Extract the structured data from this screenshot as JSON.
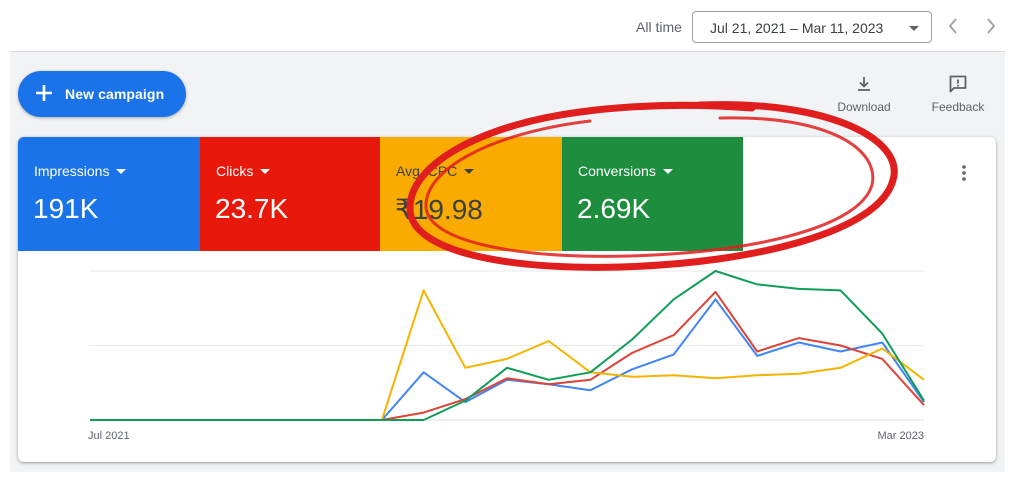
{
  "header": {
    "all_time_label": "All time",
    "date_range": "Jul 21, 2021 – Mar 11, 2023"
  },
  "toolbar": {
    "new_campaign_label": "New campaign",
    "download_label": "Download",
    "feedback_label": "Feedback"
  },
  "metrics": [
    {
      "label": "Impressions",
      "value": "191K",
      "color": "#1a73e8"
    },
    {
      "label": "Clicks",
      "value": "23.7K",
      "color": "#e8190a"
    },
    {
      "label": "Avg. CPC",
      "value": "₹19.98",
      "color": "#f9ab00"
    },
    {
      "label": "Conversions",
      "value": "2.69K",
      "color": "#1e8e3e"
    }
  ],
  "colors": {
    "annotation": "#e01e1e",
    "panel_bg": "#f1f3f4"
  },
  "chart_data": {
    "type": "line",
    "x_tick_labels": [
      "Jul 2021",
      "Mar 2023"
    ],
    "gridlines": 3,
    "ylim": [
      0,
      100
    ],
    "series": [
      {
        "name": "Impressions",
        "color": "#4285f4",
        "values": [
          0,
          0,
          0,
          0,
          0,
          0,
          0,
          0,
          32,
          12,
          27,
          24,
          20,
          34,
          44,
          81,
          43,
          52,
          46,
          52,
          12
        ]
      },
      {
        "name": "Clicks",
        "color": "#db4437",
        "values": [
          0,
          0,
          0,
          0,
          0,
          0,
          0,
          0,
          5,
          14,
          28,
          24,
          27,
          45,
          57,
          86,
          46,
          55,
          50,
          41,
          10
        ]
      },
      {
        "name": "Avg. CPC",
        "color": "#f4b400",
        "values": [
          0,
          0,
          0,
          0,
          0,
          0,
          0,
          0,
          87,
          35,
          41,
          53,
          32,
          29,
          30,
          28,
          30,
          31,
          35,
          48,
          27
        ]
      },
      {
        "name": "Conversions",
        "color": "#0f9d58",
        "values": [
          0,
          0,
          0,
          0,
          0,
          0,
          0,
          0,
          0,
          13,
          35,
          27,
          32,
          54,
          81,
          100,
          91,
          88,
          87,
          58,
          13
        ]
      }
    ]
  }
}
